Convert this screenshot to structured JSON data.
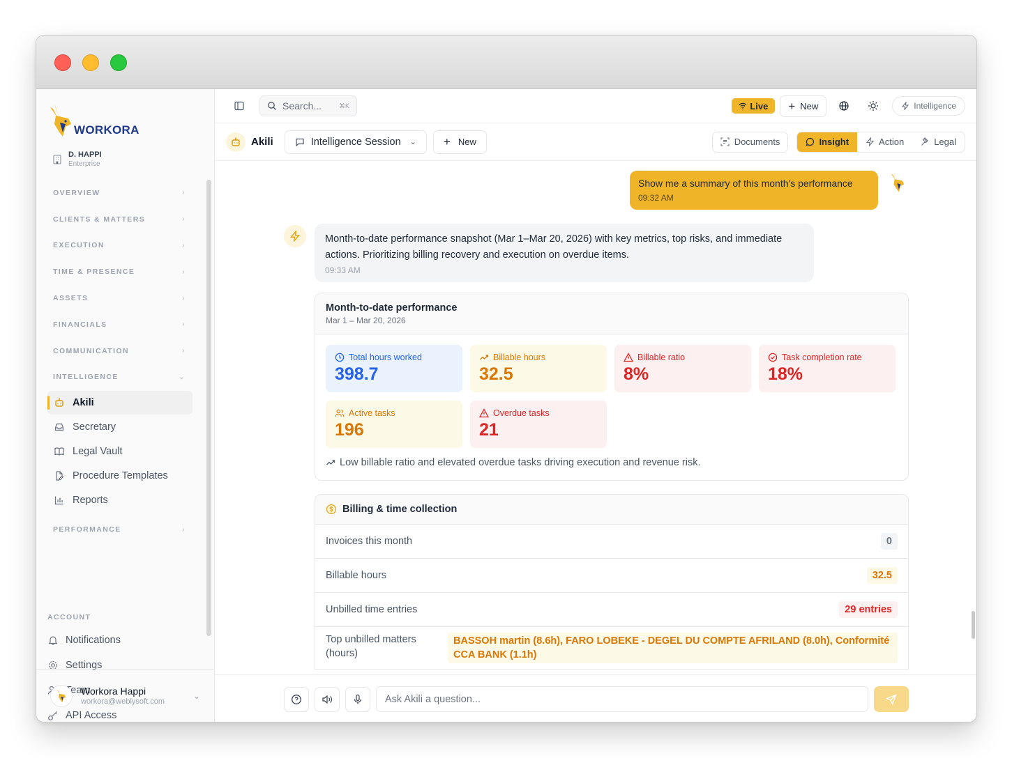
{
  "sidebar": {
    "brand": "WORKORA",
    "org": {
      "name": "D. HAPPI",
      "plan": "Enterprise"
    },
    "sections": [
      {
        "label": "OVERVIEW"
      },
      {
        "label": "CLIENTS & MATTERS"
      },
      {
        "label": "EXECUTION"
      },
      {
        "label": "TIME & PRESENCE"
      },
      {
        "label": "ASSETS"
      },
      {
        "label": "FINANCIALS"
      },
      {
        "label": "COMMUNICATION"
      },
      {
        "label": "INTELLIGENCE"
      }
    ],
    "intelligence_items": [
      {
        "label": "Akili",
        "icon": "bot-icon",
        "active": true
      },
      {
        "label": "Secretary",
        "icon": "inbox-icon"
      },
      {
        "label": "Legal Vault",
        "icon": "book-icon"
      },
      {
        "label": "Procedure Templates",
        "icon": "file-edit-icon"
      },
      {
        "label": "Reports",
        "icon": "bar-chart-icon"
      }
    ],
    "performance_label": "PERFORMANCE",
    "account_label": "ACCOUNT",
    "account_items": [
      {
        "label": "Notifications",
        "icon": "bell-icon"
      },
      {
        "label": "Settings",
        "icon": "gear-icon"
      },
      {
        "label": "Team",
        "icon": "users-icon"
      },
      {
        "label": "API Access",
        "icon": "key-icon"
      }
    ],
    "user": {
      "name": "Workora Happi",
      "email": "workora@weblysoft.com"
    }
  },
  "topbar": {
    "search_placeholder": "Search...",
    "search_shortcut": "⌘K",
    "live_label": "Live",
    "new_label": "New",
    "intelligence_label": "Intelligence"
  },
  "subbar": {
    "title": "Akili",
    "session_label": "Intelligence Session",
    "new_label": "New",
    "documents_label": "Documents",
    "modes": [
      "Insight",
      "Action",
      "Legal"
    ],
    "active_mode": "Insight"
  },
  "chat": {
    "user_message": {
      "text": "Show me a summary of this month's performance",
      "time": "09:32 AM"
    },
    "bot_message": {
      "text": "Month-to-date performance snapshot (Mar 1–Mar 20, 2026) with key metrics, top risks, and immediate actions. Prioritizing billing recovery and execution on overdue items.",
      "time": "09:33 AM"
    },
    "performance_card": {
      "title": "Month-to-date performance",
      "subtitle": "Mar 1 – Mar 20, 2026",
      "metrics": [
        {
          "label": "Total hours worked",
          "value": "398.7",
          "tone": "blue",
          "icon": "clock-icon"
        },
        {
          "label": "Billable hours",
          "value": "32.5",
          "tone": "amber",
          "icon": "trending-up-icon"
        },
        {
          "label": "Billable ratio",
          "value": "8%",
          "tone": "red",
          "icon": "alert-triangle-icon"
        },
        {
          "label": "Task completion rate",
          "value": "18%",
          "tone": "red",
          "icon": "check-circle-icon"
        },
        {
          "label": "Active tasks",
          "value": "196",
          "tone": "amber",
          "icon": "users-icon"
        },
        {
          "label": "Overdue tasks",
          "value": "21",
          "tone": "red",
          "icon": "alert-triangle-icon"
        }
      ],
      "insight": "Low billable ratio and elevated overdue tasks driving execution and revenue risk."
    },
    "billing_card": {
      "title": "Billing & time collection",
      "rows": [
        {
          "label": "Invoices this month",
          "value": "0",
          "tone": "gray"
        },
        {
          "label": "Billable hours",
          "value": "32.5",
          "tone": "amber"
        },
        {
          "label": "Unbilled time entries",
          "value": "29 entries",
          "tone": "red"
        }
      ],
      "top_unbilled_label": "Top unbilled matters (hours)",
      "top_unbilled_value": "BASSOH martin (8.6h), FARO LOBEKE - DEGEL DU COMPTE AFRILAND (8.0h), Conformité CCA BANK (1.1h)"
    }
  },
  "composer": {
    "placeholder": "Ask Akili a question..."
  },
  "colors": {
    "accent": "#f0b429",
    "brand_navy": "#1e3a8a"
  }
}
